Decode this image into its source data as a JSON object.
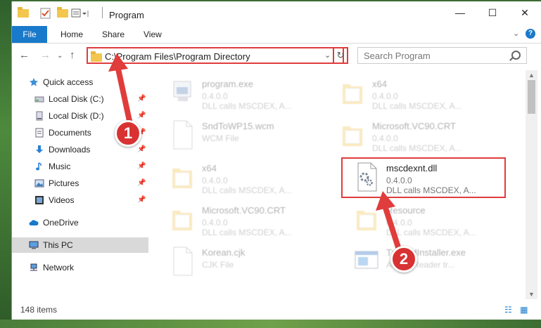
{
  "window": {
    "title": "Program",
    "controls": {
      "minimize": "—",
      "maximize": "☐",
      "close": "✕"
    }
  },
  "ribbon": {
    "tabs": [
      "File",
      "Home",
      "Share",
      "View"
    ],
    "expand": "⌄",
    "help": "?"
  },
  "nav": {
    "back": "←",
    "forward": "→",
    "recent": "⌄",
    "up": "↑",
    "address": "C:\\Program Files\\Program Directory",
    "address_dropdown": "⌄",
    "refresh": "↻",
    "search_placeholder": "Search Program"
  },
  "sidebar": {
    "items": [
      {
        "label": "Quick access",
        "icon": "star-icon",
        "pinned": false
      },
      {
        "label": "Local Disk (C:)",
        "icon": "drive-icon",
        "pinned": true
      },
      {
        "label": "Local Disk (D:)",
        "icon": "drive-icon",
        "pinned": true
      },
      {
        "label": "Documents",
        "icon": "documents-icon",
        "pinned": true
      },
      {
        "label": "Downloads",
        "icon": "download-icon",
        "pinned": true
      },
      {
        "label": "Music",
        "icon": "music-icon",
        "pinned": true
      },
      {
        "label": "Pictures",
        "icon": "pictures-icon",
        "pinned": true
      },
      {
        "label": "Videos",
        "icon": "videos-icon",
        "pinned": true
      },
      {
        "label": "OneDrive",
        "icon": "cloud-icon",
        "pinned": false
      },
      {
        "label": "This PC",
        "icon": "computer-icon",
        "pinned": false,
        "selected": true
      },
      {
        "label": "Network",
        "icon": "network-icon",
        "pinned": false
      }
    ],
    "pin_glyph": "📌"
  },
  "files": [
    {
      "name": "program.exe",
      "line2": "0.4.0.0",
      "line3": "DLL calls MSCDEX, A...",
      "kind": "exe"
    },
    {
      "name": "x64",
      "line2": "0.4.0.0",
      "line3": "DLL calls MSCDEX, A...",
      "kind": "folder"
    },
    {
      "name": "SndToWP15.wcm",
      "line2": "WCM File",
      "line3": "",
      "kind": "doc"
    },
    {
      "name": "Microsoft.VC90.CRT",
      "line2": "0.4.0.0",
      "line3": "DLL calls MSCDEX, A...",
      "kind": "folder"
    },
    {
      "name": "x64",
      "line2": "0.4.0.0",
      "line3": "DLL calls MSCDEX, A...",
      "kind": "folder"
    },
    {
      "name": "mscdexnt.dll",
      "line2": "0.4.0.0",
      "line3": "DLL calls MSCDEX, A...",
      "kind": "dll"
    },
    {
      "name": "Microsoft.VC90.CRT",
      "line2": "0.4.0.0",
      "line3": "DLL calls MSCDEX, A...",
      "kind": "folder"
    },
    {
      "name": "Resource",
      "line2": "0.4.0.0",
      "line3": "DLL calls MSCDEX, A...",
      "kind": "folder"
    },
    {
      "name": "Korean.cjk",
      "line2": "CJK File",
      "line3": "",
      "kind": "doc"
    },
    {
      "name": "TrustedInstaller.exe",
      "line2": "Adobe Reader tr...",
      "line3": "",
      "kind": "app"
    }
  ],
  "status": {
    "count": "148 items",
    "view_icons": "☷ ▦"
  },
  "annotations": {
    "badge1": "1",
    "badge2": "2"
  },
  "colors": {
    "accent": "#1979ca",
    "highlight": "#e03c3c",
    "folder": "#f3c64e"
  }
}
